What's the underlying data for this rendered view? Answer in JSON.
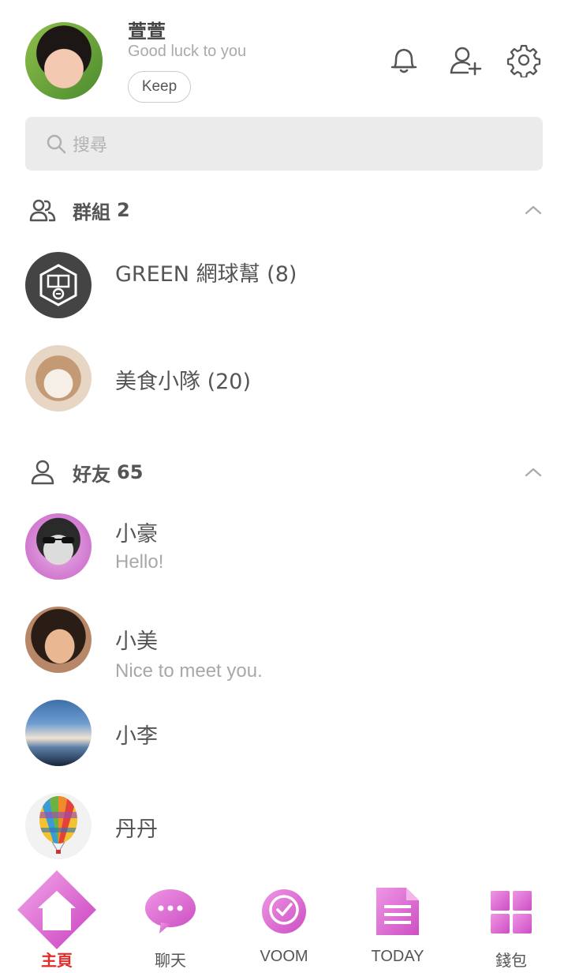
{
  "profile": {
    "name": "萱萱",
    "status": "Good luck to you",
    "keep_label": "Keep"
  },
  "header_icons": [
    "bell-icon",
    "add-friend-icon",
    "settings-gear-icon"
  ],
  "search": {
    "placeholder": "搜尋"
  },
  "groups": {
    "title": "群組",
    "count": "2",
    "items": [
      {
        "name": "GREEN 網球幫 (8)"
      },
      {
        "name": "美食小隊 (20)"
      }
    ]
  },
  "friends": {
    "title": "好友",
    "count": "65",
    "items": [
      {
        "name": "小豪",
        "message": "Hello!"
      },
      {
        "name": "小美",
        "message": "Nice to meet you."
      },
      {
        "name": "小李",
        "message": ""
      },
      {
        "name": "丹丹",
        "message": ""
      }
    ]
  },
  "nav": {
    "items": [
      {
        "label": "主頁",
        "icon": "home-icon",
        "active": true
      },
      {
        "label": "聊天",
        "icon": "chat-icon",
        "active": false
      },
      {
        "label": "VOOM",
        "icon": "voom-clock-icon",
        "active": false
      },
      {
        "label": "TODAY",
        "icon": "today-news-icon",
        "active": false
      },
      {
        "label": "錢包",
        "icon": "wallet-grid-icon",
        "active": false
      }
    ]
  },
  "colors": {
    "accent_active": "#e52a2a",
    "nav_icon_pink": "#d65ec9",
    "search_bg": "#ebebeb",
    "text_primary": "#555555",
    "text_secondary": "#a8a8a8"
  }
}
